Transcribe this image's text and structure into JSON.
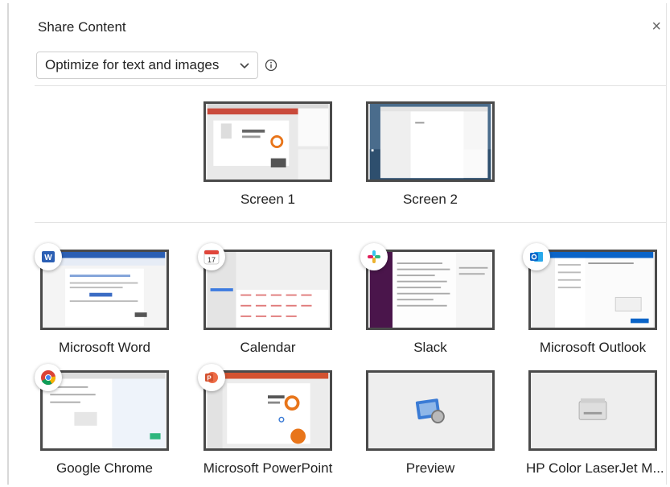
{
  "dialog": {
    "title": "Share Content",
    "close_symbol": "×"
  },
  "optimize": {
    "selected": "Optimize for text and images",
    "chevron_icon": "chevron-down-icon",
    "info_icon": "info-icon"
  },
  "screens": [
    {
      "label": "Screen 1"
    },
    {
      "label": "Screen 2"
    }
  ],
  "apps": [
    {
      "label": "Microsoft Word",
      "icon": "word-icon",
      "color": "#2b5fb4"
    },
    {
      "label": "Calendar",
      "icon": "calendar-icon",
      "icon_text": "17",
      "color": "#e0453a"
    },
    {
      "label": "Slack",
      "icon": "slack-icon",
      "color": "#4a154b"
    },
    {
      "label": "Microsoft Outlook",
      "icon": "outlook-icon",
      "color": "#0a64c8"
    },
    {
      "label": "Google Chrome",
      "icon": "chrome-icon",
      "color": "#db4437"
    },
    {
      "label": "Microsoft PowerPoint",
      "icon": "powerpoint-icon",
      "color": "#d35230"
    },
    {
      "label": "Preview",
      "icon": "preview-icon",
      "color": "#3a7bd5"
    },
    {
      "label": "HP Color LaserJet M...",
      "icon": "printer-icon",
      "color": "#cccccc"
    }
  ]
}
